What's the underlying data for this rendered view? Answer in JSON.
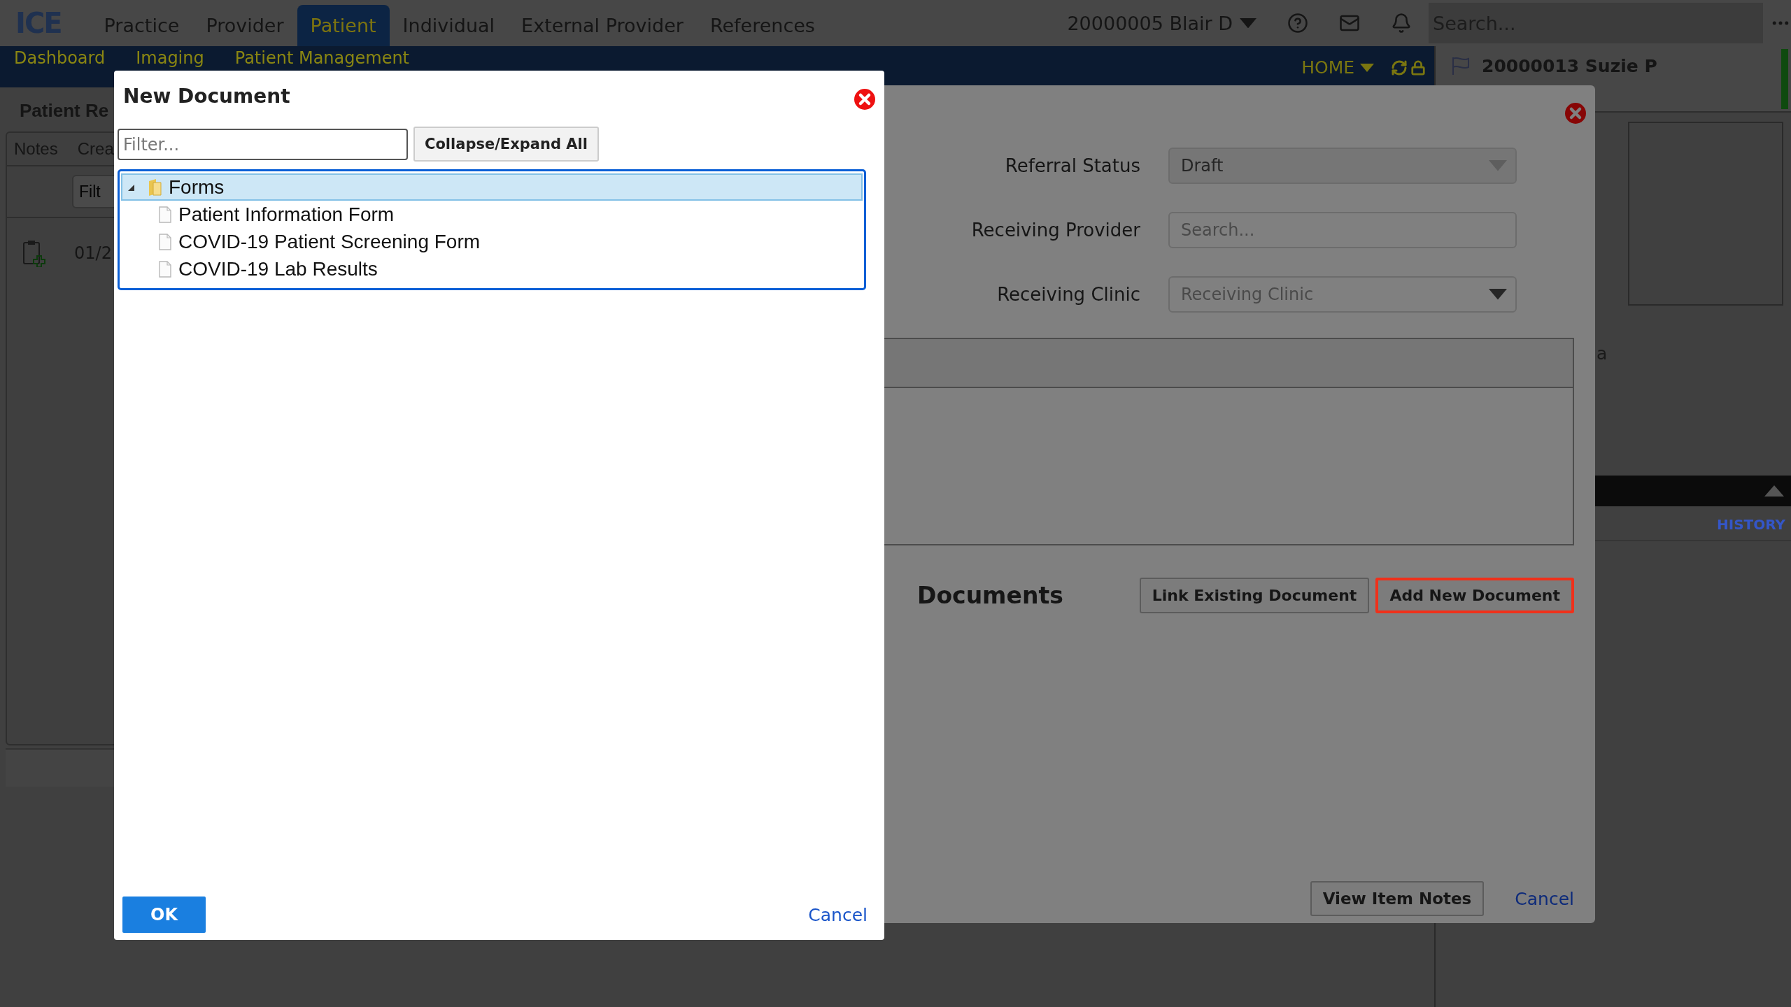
{
  "top_nav": {
    "logo": "ICE",
    "items": [
      {
        "label": "Practice",
        "selected": false
      },
      {
        "label": "Provider",
        "selected": false
      },
      {
        "label": "Patient",
        "selected": true
      },
      {
        "label": "Individual",
        "selected": false
      },
      {
        "label": "External Provider",
        "selected": false
      },
      {
        "label": "References",
        "selected": false
      }
    ],
    "user": "20000005 Blair D",
    "search": {
      "placeholder": "Search..."
    }
  },
  "sub_nav": {
    "items": [
      "Dashboard",
      "Imaging",
      "Patient Management"
    ],
    "home": "HOME"
  },
  "left_panel": {
    "title": "Patient Re",
    "tabs": [
      "Notes",
      "Crea"
    ],
    "filter": {
      "placeholder": "Filt"
    },
    "rows": [
      {
        "date": "01/2"
      }
    ]
  },
  "patient_panel": {
    "name": "20000013 Suzie P",
    "fragment": "a",
    "history": "HISTORY"
  },
  "referral_dialog": {
    "fields": [
      {
        "label": "Referral Status",
        "kind": "select",
        "value": "Draft",
        "disabled": true
      },
      {
        "label": "Receiving Provider",
        "kind": "search",
        "placeholder": "Search..."
      },
      {
        "label": "Receiving Clinic",
        "kind": "select",
        "placeholder": "Receiving Clinic",
        "disabled": false
      }
    ],
    "documents_title": "Documents",
    "buttons": [
      {
        "label": "Link Existing Document",
        "highlighted": false
      },
      {
        "label": "Add New Document",
        "highlighted": true
      }
    ],
    "notes_button": "View Item Notes",
    "cancel": "Cancel"
  },
  "new_document_dialog": {
    "title": "New Document",
    "filter": {
      "placeholder": "Filter..."
    },
    "collapse_button": "Collapse/Expand All",
    "tree": [
      {
        "label": "Forms",
        "kind": "folder",
        "expanded": true,
        "selected": true,
        "children": [
          {
            "label": "Patient Information Form",
            "kind": "file",
            "selected": false
          },
          {
            "label": "COVID-19 Patient Screening Form",
            "kind": "file",
            "selected": false
          },
          {
            "label": "COVID-19 Lab Results",
            "kind": "file",
            "selected": false
          }
        ]
      }
    ],
    "ok": "OK",
    "cancel": "Cancel"
  }
}
